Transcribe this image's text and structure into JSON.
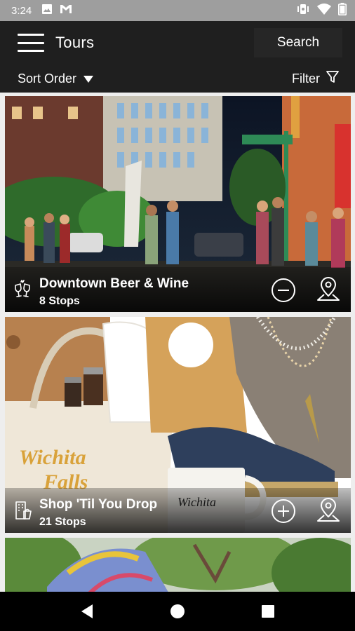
{
  "status_bar": {
    "time": "3:24",
    "icons": [
      "image-icon",
      "gmail-icon",
      "vibrate-icon",
      "wifi-icon",
      "battery-icon"
    ]
  },
  "app_bar": {
    "title": "Tours",
    "search_label": "Search",
    "menu_icon": "hamburger-menu-icon"
  },
  "sub_bar": {
    "sort_label": "Sort Order",
    "filter_label": "Filter"
  },
  "tours": [
    {
      "title": "Downtown Beer & Wine",
      "stops": "8 Stops",
      "category_icon": "wine-glasses-icon",
      "action_icon": "remove-circle-icon",
      "image": "night street scene with people"
    },
    {
      "title": "Shop 'Til You Drop",
      "stops": "21 Stops",
      "category_icon": "shopping-building-icon",
      "action_icon": "add-circle-icon",
      "image": "retail goods: tote bag, mug, necklaces, shoes"
    },
    {
      "title": "",
      "stops": "",
      "image": "colorful mural and trees"
    }
  ],
  "colors": {
    "status_bar": "#9e9e9e",
    "app_bar": "#1f1f1f",
    "list_background": "#eeeeee",
    "nav_bar": "#000000"
  }
}
